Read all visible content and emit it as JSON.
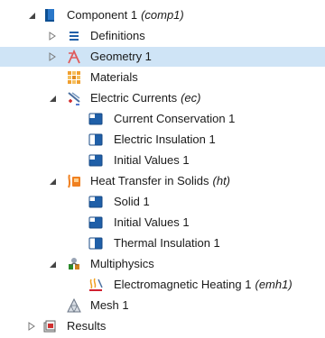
{
  "tree": {
    "component": {
      "label": "Component 1",
      "tag": "(comp1)",
      "icon": "component-icon",
      "expanded": true
    },
    "definitions": {
      "label": "Definitions",
      "icon": "definitions-icon",
      "expanded": false
    },
    "geometry": {
      "label": "Geometry 1",
      "icon": "geometry-icon",
      "expanded": false,
      "selected": true
    },
    "materials": {
      "label": "Materials",
      "icon": "materials-icon"
    },
    "electric_currents": {
      "label": "Electric Currents",
      "tag": "(ec)",
      "icon": "electric-currents-icon",
      "expanded": true
    },
    "current_conservation": {
      "label": "Current Conservation 1",
      "icon": "domain-feature-icon"
    },
    "electric_insulation": {
      "label": "Electric Insulation 1",
      "icon": "boundary-feature-icon"
    },
    "initial_values_ec": {
      "label": "Initial Values 1",
      "icon": "domain-feature-icon"
    },
    "heat_transfer": {
      "label": "Heat Transfer in Solids",
      "tag": "(ht)",
      "icon": "heat-transfer-icon",
      "expanded": true
    },
    "solid": {
      "label": "Solid 1",
      "icon": "domain-feature-icon"
    },
    "initial_values_ht": {
      "label": "Initial Values 1",
      "icon": "domain-feature-icon"
    },
    "thermal_insulation": {
      "label": "Thermal Insulation 1",
      "icon": "boundary-feature-icon"
    },
    "multiphysics": {
      "label": "Multiphysics",
      "icon": "multiphysics-icon",
      "expanded": true
    },
    "em_heating": {
      "label": "Electromagnetic Heating 1",
      "tag": "(emh1)",
      "icon": "em-heating-icon"
    },
    "mesh": {
      "label": "Mesh 1",
      "icon": "mesh-icon"
    },
    "results": {
      "label": "Results",
      "icon": "results-icon",
      "expanded": false
    }
  },
  "colors": {
    "selection": "#cfe4f6",
    "feature_blue": "#1f5fa8",
    "geometry_red": "#e05a5a",
    "materials_orange": "#f0a030",
    "heat_orange": "#f08020"
  }
}
